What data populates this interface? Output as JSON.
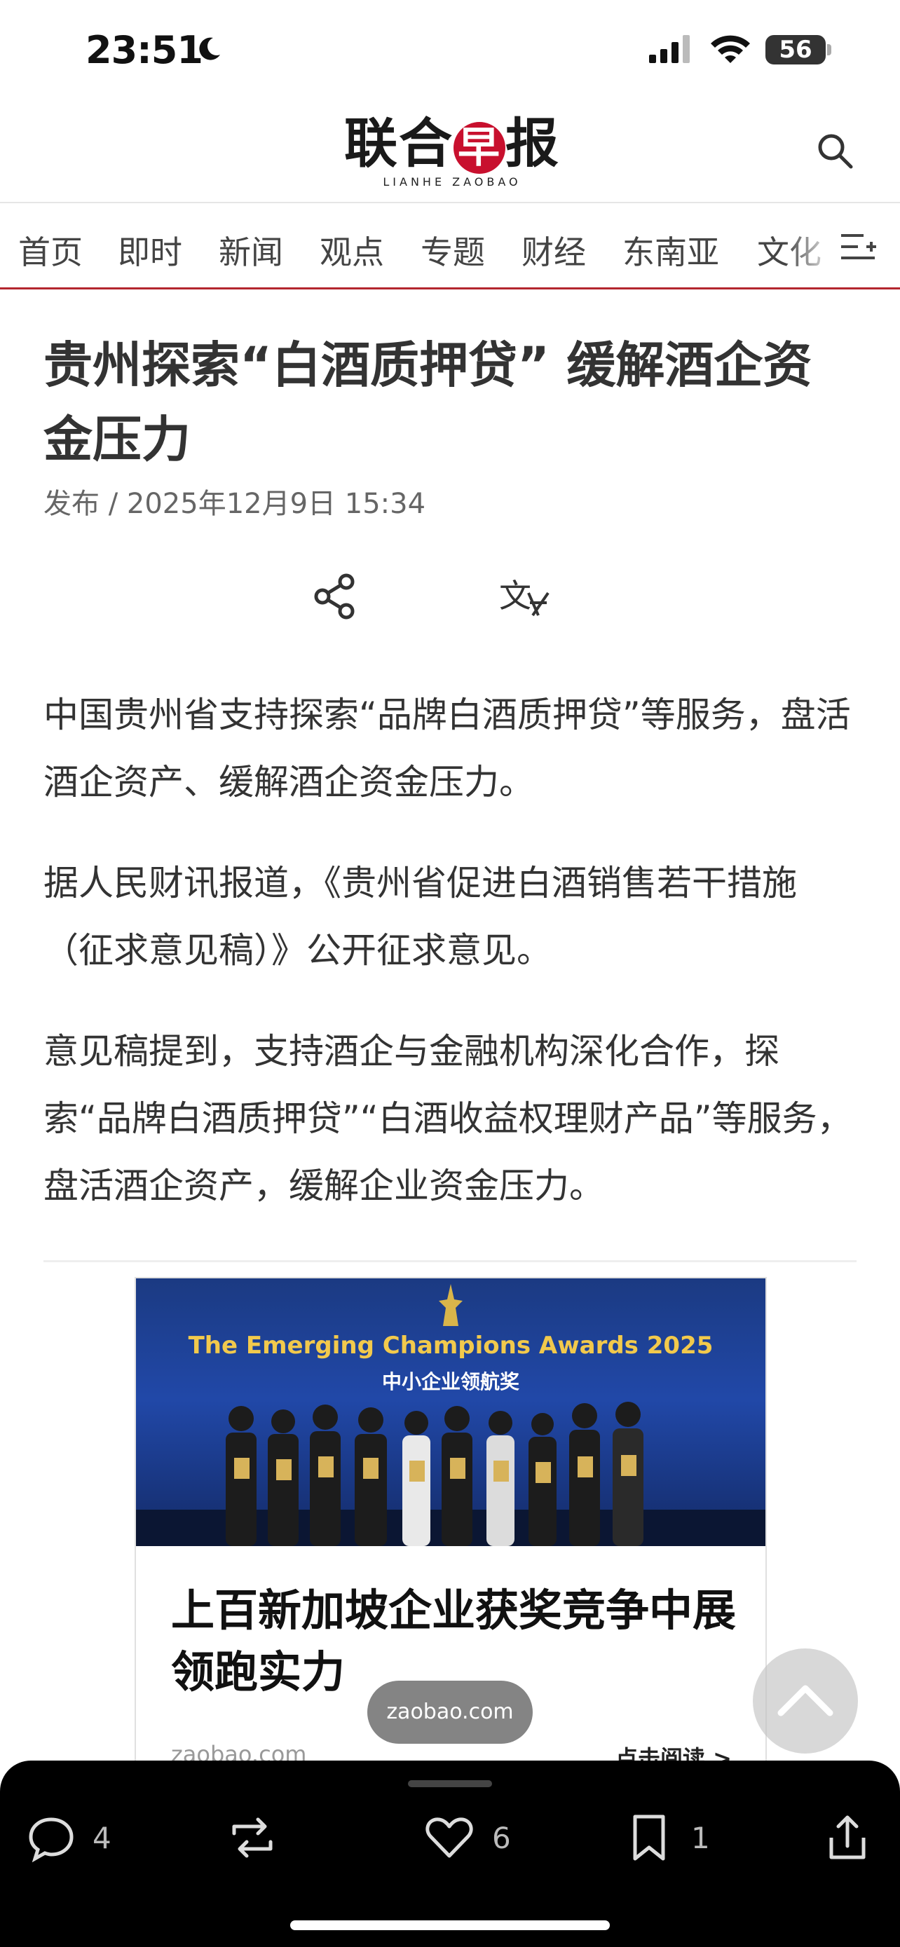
{
  "status_bar": {
    "time": "23:51",
    "battery": "56"
  },
  "masthead": {
    "logo_cn_1": "联合",
    "logo_cn_red": "早",
    "logo_cn_2": "报",
    "logo_en": "LIANHE ZAOBAO"
  },
  "nav": {
    "items": [
      "首页",
      "即时",
      "新闻",
      "观点",
      "专题",
      "财经",
      "东南亚",
      "文化"
    ]
  },
  "article": {
    "title": "贵州探索“白酒质押贷” 缓解酒企资金压力",
    "published": "发布 / 2025年12月9日 15:34",
    "paragraphs": [
      "中国贵州省支持探索“品牌白酒质押贷”等服务，盘活酒企资产、缓解酒企资金压力。",
      "据人民财讯报道，《贵州省促进白酒销售若干措施（征求意见稿）》公开征求意见。",
      "意见稿提到，支持酒企与金融机构深化合作，探索“品牌白酒质押贷”“白酒收益权理财产品”等服务，盘活酒企资产，缓解企业资金压力。"
    ]
  },
  "ad": {
    "award_title": "The Emerging Champions Awards 2025",
    "award_sub": "中小企业领航奖",
    "headline": "上百新加坡企业获奖竞争中展领跑实力",
    "site": "zaobao.com",
    "read_more": "点击阅读 >"
  },
  "url_pill": "zaobao.com",
  "toolbar": {
    "comments": "4",
    "likes": "6",
    "bookmarks": "1"
  },
  "colors": {
    "brand_red": "#c8102e",
    "nav_underline": "#b3262e"
  }
}
